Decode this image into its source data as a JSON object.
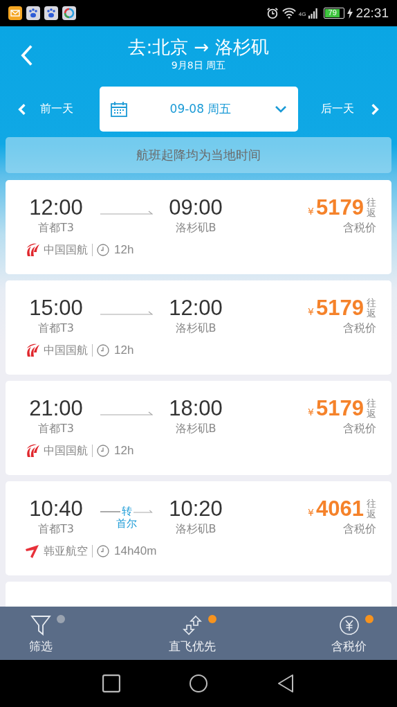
{
  "status_bar": {
    "notifications": [
      {
        "kind": "mail"
      },
      {
        "kind": "paw"
      },
      {
        "kind": "paw"
      },
      {
        "kind": "ring"
      }
    ],
    "network": "4G",
    "battery": "79",
    "time": "22:31"
  },
  "header": {
    "title": "去:北京 → 洛杉矶",
    "subtitle": "9月8日 周五"
  },
  "date_bar": {
    "prev": "前一天",
    "date": "09-08 周五",
    "next": "后一天"
  },
  "notice": "航班起降均为当地时间",
  "flights": [
    {
      "depart_time": "12:00",
      "depart_airport": "首都T3",
      "arrive_time": "09:00",
      "arrive_airport": "洛杉矶B",
      "currency": "¥",
      "price": "5179",
      "trip": "往返",
      "price_note": "含税价",
      "kind": "swirl_logo",
      "airline": "中国国航",
      "duration": "12h"
    },
    {
      "depart_time": "15:00",
      "depart_airport": "首都T3",
      "arrive_time": "12:00",
      "arrive_airport": "洛杉矶B",
      "currency": "¥",
      "price": "5179",
      "trip": "往返",
      "price_note": "含税价",
      "kind": "swirl_logo",
      "airline": "中国国航",
      "duration": "12h"
    },
    {
      "depart_time": "21:00",
      "depart_airport": "首都T3",
      "arrive_time": "18:00",
      "arrive_airport": "洛杉矶B",
      "currency": "¥",
      "price": "5179",
      "trip": "往返",
      "price_note": "含税价",
      "kind": "swirl_logo",
      "airline": "中国国航",
      "duration": "12h"
    },
    {
      "depart_time": "10:40",
      "depart_airport": "首都T3",
      "arrive_time": "10:20",
      "arrive_airport": "洛杉矶B",
      "transfer": {
        "label": "转",
        "city": "首尔"
      },
      "currency": "¥",
      "price": "4061",
      "trip": "往返",
      "price_note": "含税价",
      "kind": "wing_logo",
      "airline": "韩亚航空",
      "duration": "14h40m"
    }
  ],
  "bottom_bar": [
    {
      "kind": "filter",
      "label": "筛选",
      "on": false
    },
    {
      "kind": "direct",
      "label": "直飞优先",
      "on": true
    },
    {
      "kind": "tax",
      "label": "含税价",
      "on": true
    }
  ]
}
